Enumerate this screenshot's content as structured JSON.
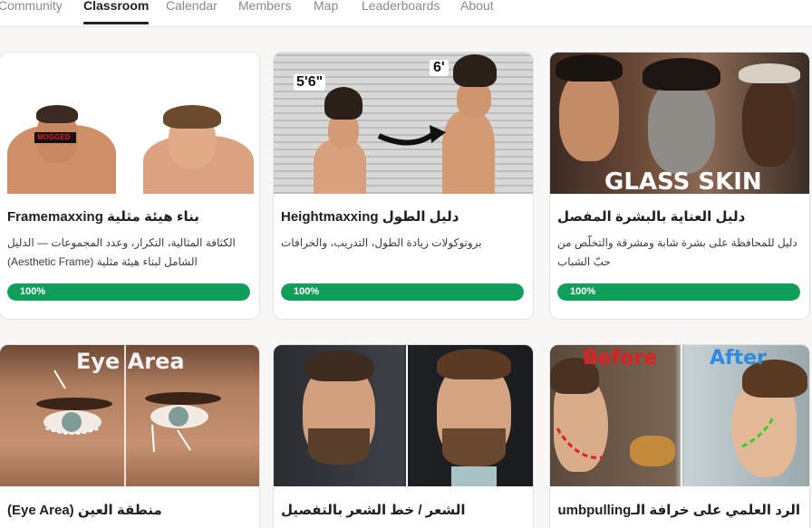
{
  "nav": {
    "tabs": [
      "Community",
      "Classroom",
      "Calendar",
      "Members",
      "Map",
      "Leaderboards",
      "About"
    ],
    "active": "Classroom"
  },
  "courses": [
    {
      "title": "Framemaxxing بناء هيئة مثلية",
      "description": "الكثافة المثالية، التكرار، وعدد المجموعات — الدليل الشامل لبناء هيئة مثلية (Aesthetic Frame)",
      "progress_label": "100%",
      "progress": 1.0,
      "thumb_text": "MOGGED"
    },
    {
      "title": "Heightmaxxing دليل الطول",
      "description": "بروتوكولات زيادة الطول، التدريب، والخرافات",
      "progress_label": "100%",
      "progress": 1.0,
      "thumb_text_left": "5'6\"",
      "thumb_text_right": "6'"
    },
    {
      "title": "دليل العناية بالبشرة المفصل",
      "description": "دليل للمحافظة على بشرة شابة ومشرقة والتخلّص من حبّ الشباب",
      "progress_label": "100%",
      "progress": 1.0,
      "thumb_text": "GLASS SKIN"
    },
    {
      "title": "منطقة العين (Eye Area)",
      "thumb_text": "Eye Area"
    },
    {
      "title": "الشعر / خط الشعر بالتفصيل"
    },
    {
      "title": "الرد العلمي على خرافة الـThumbpulling",
      "thumb_text_left": "Before",
      "thumb_text_right": "After"
    }
  ],
  "colors": {
    "accent_green": "#109e5b",
    "before_red": "#e02020",
    "after_blue": "#2f8be0"
  }
}
